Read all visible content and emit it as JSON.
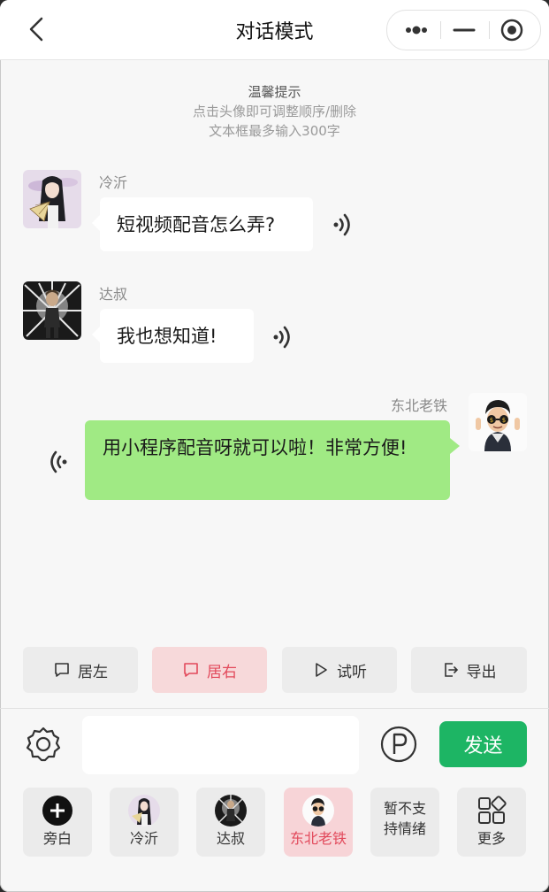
{
  "nav": {
    "title": "对话模式"
  },
  "tips": {
    "heading": "温馨提示",
    "line1": "点击头像即可调整顺序/删除",
    "line2": "文本框最多输入300字"
  },
  "messages": [
    {
      "speaker": "冷沂",
      "text": "短视频配音怎么弄?",
      "side": "left"
    },
    {
      "speaker": "达叔",
      "text": "我也想知道!",
      "side": "left"
    },
    {
      "speaker": "东北老铁",
      "text": "用小程序配音呀就可以啦！非常方便!",
      "side": "right"
    }
  ],
  "actions": [
    {
      "label": "居左",
      "icon": "chat-bubble-icon",
      "active": false
    },
    {
      "label": "居右",
      "icon": "chat-bubble-icon",
      "active": true
    },
    {
      "label": "试听",
      "icon": "play-icon",
      "active": false
    },
    {
      "label": "导出",
      "icon": "export-icon",
      "active": false
    }
  ],
  "input": {
    "value": "",
    "send_label": "发送"
  },
  "tiles": [
    {
      "label": "旁白",
      "icon": "add-circle-icon",
      "selected": false
    },
    {
      "label": "冷沂",
      "icon": "avatar",
      "selected": false
    },
    {
      "label": "达叔",
      "icon": "avatar",
      "selected": false
    },
    {
      "label": "东北老铁",
      "icon": "avatar",
      "selected": true
    },
    {
      "label": "暂不支持情绪",
      "line1": "暂不支",
      "line2": "持情绪",
      "selected": false
    },
    {
      "label": "更多",
      "icon": "grid-icon",
      "selected": false
    }
  ],
  "colors": {
    "send": "#1db564",
    "bubble_self": "#a0ea84",
    "accent": "#e2495b"
  }
}
